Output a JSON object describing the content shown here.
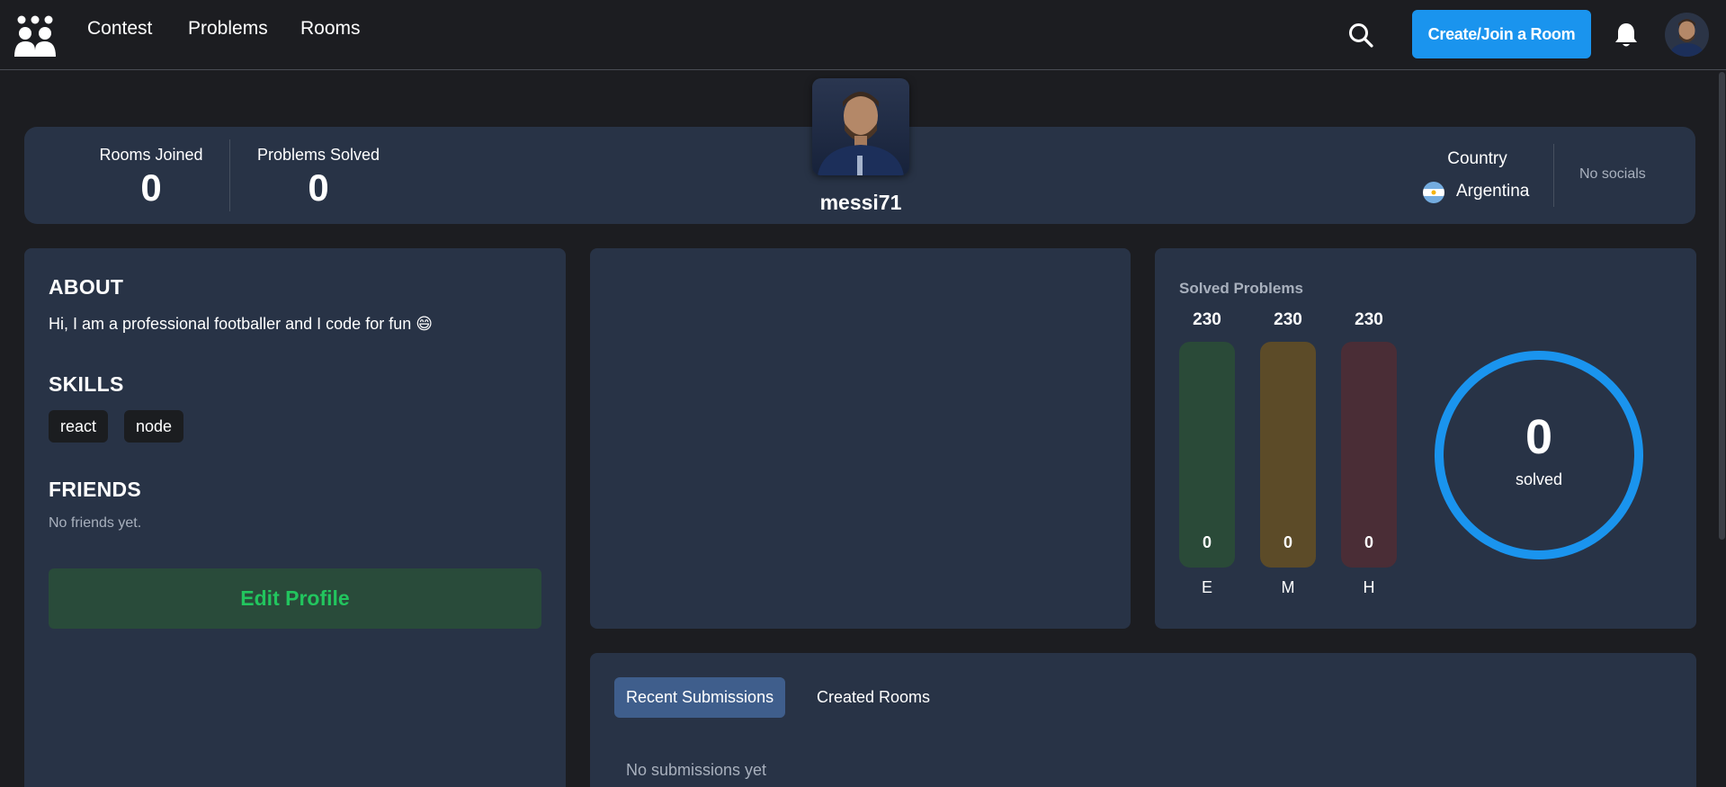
{
  "nav": {
    "links": [
      "Contest",
      "Problems",
      "Rooms"
    ],
    "create_label": "Create/Join a Room",
    "accent": "#1a94ee"
  },
  "stats": {
    "rooms_joined_label": "Rooms Joined",
    "rooms_joined_value": "0",
    "problems_solved_label": "Problems Solved",
    "problems_solved_value": "0"
  },
  "profile": {
    "username": "messi71",
    "country_label": "Country",
    "country_name": "Argentina",
    "socials": "No socials"
  },
  "about": {
    "title": "ABOUT",
    "text": "Hi, I am a professional footballer and I code for fun 😄"
  },
  "skills": {
    "title": "SKILLS",
    "items": [
      "react",
      "node"
    ]
  },
  "friends": {
    "title": "FRIENDS",
    "empty": "No friends yet."
  },
  "edit_profile_label": "Edit Profile",
  "solved": {
    "title": "Solved Problems",
    "bars": [
      {
        "label": "E",
        "total": "230",
        "value": "0",
        "color": "#2a4a38"
      },
      {
        "label": "M",
        "total": "230",
        "value": "0",
        "color": "#5c4b28"
      },
      {
        "label": "H",
        "total": "230",
        "value": "0",
        "color": "#4a2d36"
      }
    ],
    "ring_value": "0",
    "ring_label": "solved",
    "ring_color": "#1a94ee"
  },
  "tabs": {
    "items": [
      "Recent Submissions",
      "Created Rooms"
    ],
    "active": 0,
    "empty": "No submissions yet"
  }
}
